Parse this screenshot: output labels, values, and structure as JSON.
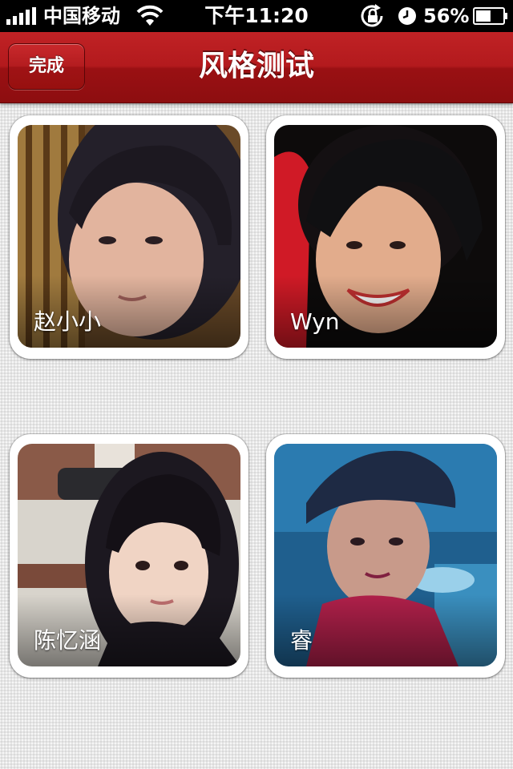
{
  "status_bar": {
    "carrier": "中国移动",
    "time": "下午11:20",
    "battery_percent": "56%",
    "battery_level": 0.56,
    "icons": [
      "signal-icon",
      "wifi-icon",
      "rotation-lock-icon",
      "alarm-icon",
      "battery-icon"
    ]
  },
  "nav_bar": {
    "done_label": "完成",
    "title": "风格测试"
  },
  "profiles": [
    {
      "name": "赵小小"
    },
    {
      "name": "Wyn"
    },
    {
      "name": "陈忆涵"
    },
    {
      "name": "睿"
    }
  ],
  "colors": {
    "nav_red": "#b31a1d",
    "background": "#e6e6e6",
    "card_white": "#ffffff"
  }
}
